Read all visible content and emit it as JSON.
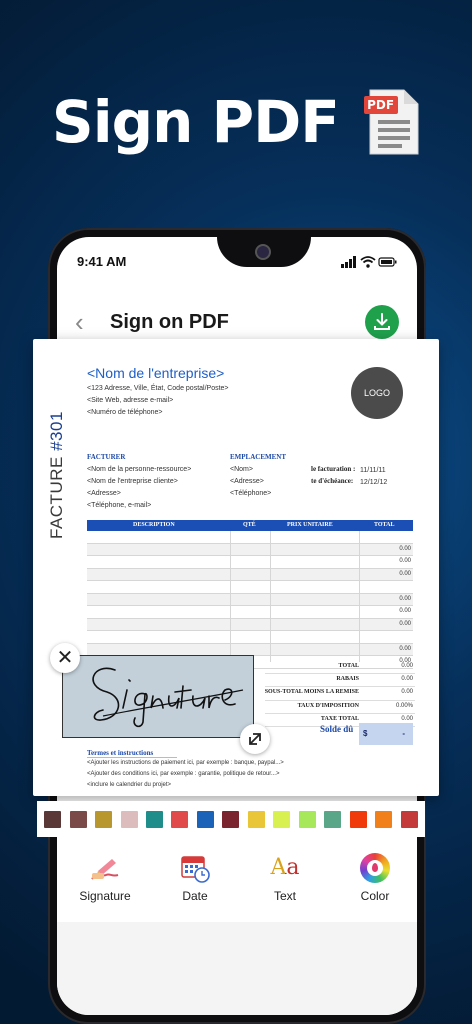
{
  "hero": {
    "title": "Sign PDF",
    "pdf_badge": "PDF"
  },
  "status_bar": {
    "time": "9:41 AM"
  },
  "header": {
    "title": "Sign on PDF"
  },
  "invoice": {
    "vertical_title": "FACTURE",
    "vertical_number": "#301",
    "company_name": "<Nom de l'entreprise>",
    "address_line": "<123 Adresse, Ville, État, Code postal/Poste>",
    "website_line": "<Site Web, adresse e-mail>",
    "phone_line": "<Numéro de téléphone>",
    "logo_text": "LOGO",
    "billing_heading": "FACTURER",
    "billing_lines": [
      "<Nom de la personne-ressource>",
      "<Nom de l'entreprise cliente>",
      "<Adresse>",
      "<Téléphone, e-mail>"
    ],
    "location_heading": "EMPLACEMENT",
    "location_lines": [
      "<Nom>",
      "<Adresse>",
      "<Téléphone>"
    ],
    "invoice_date_label": "le facturation :",
    "invoice_date_value": "11/11/11",
    "due_date_label": "te d'échéance:",
    "due_date_value": "12/12/12",
    "table_headers": [
      "DESCRIPTION",
      "QTÉ",
      "PRIX UNITAIRE",
      "TOTAL"
    ],
    "row_values": [
      "",
      "0.00",
      "0.00",
      "0.00",
      "",
      "0.00",
      "0.00",
      "0.00",
      "",
      "0.00",
      "0.00"
    ],
    "totals": [
      {
        "label": "TOTAL",
        "value": "0.00"
      },
      {
        "label": "RABAIS",
        "value": "0.00"
      },
      {
        "label": "SOUS-TOTAL MOINS LA REMISE",
        "value": "0.00"
      },
      {
        "label": "TAUX D'IMPOSITION",
        "value": "0.00%"
      },
      {
        "label": "TAXE TOTAL",
        "value": "0.00"
      }
    ],
    "balance_due_label": "Solde dû",
    "balance_due_currency": "$",
    "balance_due_value": "-",
    "terms_heading": "Termes et instructions",
    "terms_lines": [
      "<Ajouter les instructions de paiement ici, par exemple : banque, paypal...>",
      "<Ajouter des conditions ici, par exemple : garantie, politique de retour...>",
      "<inclure le calendrier du projet>"
    ]
  },
  "signature": {
    "text": "Signature"
  },
  "palette": [
    "#5a3838",
    "#7a4a48",
    "#b8982e",
    "#dcbcbc",
    "#1f8e8a",
    "#e04a4a",
    "#1b63b8",
    "#7a2430",
    "#e8c638",
    "#d8f050",
    "#a6e85a",
    "#5aa688",
    "#f03a0a",
    "#f2801a",
    "#c43a3a"
  ],
  "toolbar": {
    "items": [
      {
        "label": "Signature",
        "icon": "signature-pen-icon"
      },
      {
        "label": "Date",
        "icon": "calendar-clock-icon"
      },
      {
        "label": "Text",
        "icon": "text-aa-icon",
        "glyph": "Aa"
      },
      {
        "label": "Color",
        "icon": "color-wheel-icon"
      }
    ]
  },
  "colors": {
    "accent": "#1fa14c",
    "invoice_blue": "#1c4fb5"
  }
}
